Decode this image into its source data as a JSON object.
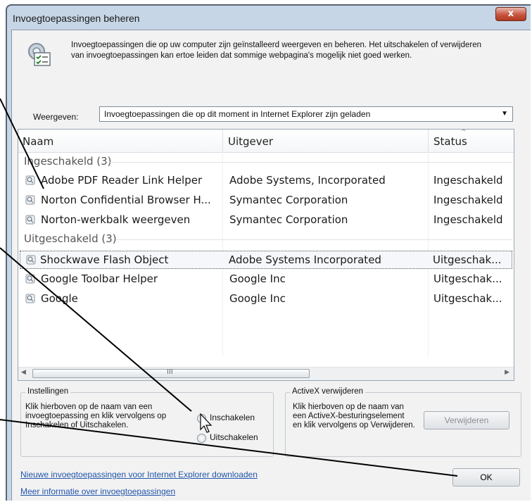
{
  "window": {
    "title": "Invoegtoepassingen beheren",
    "close_glyph": "x"
  },
  "intro": {
    "text": "Invoegtoepassingen die op uw computer zijn geïnstalleerd weergeven en beheren. Het uitschakelen of verwijderen van invoegtoepassingen kan ertoe leiden dat sommige webpagina's mogelijk niet goed werken."
  },
  "show": {
    "label": "Weergeven:",
    "selected": "Invoegtoepassingen die op dit moment in Internet Explorer zijn geladen"
  },
  "list": {
    "columns": [
      "Naam",
      "Uitgever",
      "Status"
    ],
    "groups": [
      {
        "label": "Ingeschakeld (3)",
        "rows": [
          {
            "name": "Adobe PDF Reader Link Helper",
            "publisher": "Adobe Systems, Incorporated",
            "status": "Ingeschakeld"
          },
          {
            "name": "Norton Confidential Browser H...",
            "publisher": "Symantec Corporation",
            "status": "Ingeschakeld"
          },
          {
            "name": "Norton-werkbalk weergeven",
            "publisher": "Symantec Corporation",
            "status": "Ingeschakeld"
          }
        ]
      },
      {
        "label": "Uitgeschakeld (3)",
        "rows": [
          {
            "name": "Shockwave Flash Object",
            "publisher": "Adobe Systems Incorporated",
            "status": "Uitgeschak..."
          },
          {
            "name": "Google Toolbar Helper",
            "publisher": "Google Inc",
            "status": "Uitgeschak..."
          },
          {
            "name": "Google",
            "publisher": "Google Inc",
            "status": "Uitgeschak..."
          }
        ]
      }
    ],
    "selected_row": "Shockwave Flash Object"
  },
  "settings": {
    "legend": "Instellingen",
    "text": "Klik hierboven op de naam van een invoegtoepassing en klik vervolgens op Inschakelen of Uitschakelen.",
    "enable_label": "Inschakelen",
    "disable_label": "Uitschakelen"
  },
  "activex": {
    "legend": "ActiveX verwijderen",
    "text": "Klik hierboven op de naam van een ActiveX-besturingselement en klik vervolgens op Verwijderen.",
    "remove_label": "Verwijderen"
  },
  "links": {
    "download": "Nieuwe invoegtoepassingen voor Internet Explorer downloaden",
    "more_info": "Meer informatie over invoegtoepassingen"
  },
  "ok_label": "OK",
  "scrollbar": {
    "grip": "III",
    "left": "◀",
    "right": "▶"
  },
  "colors": {
    "window_frame": "#c6d6e6",
    "client_bg": "#f2f2f2",
    "link": "#2255aa",
    "close": "#c9553f"
  }
}
